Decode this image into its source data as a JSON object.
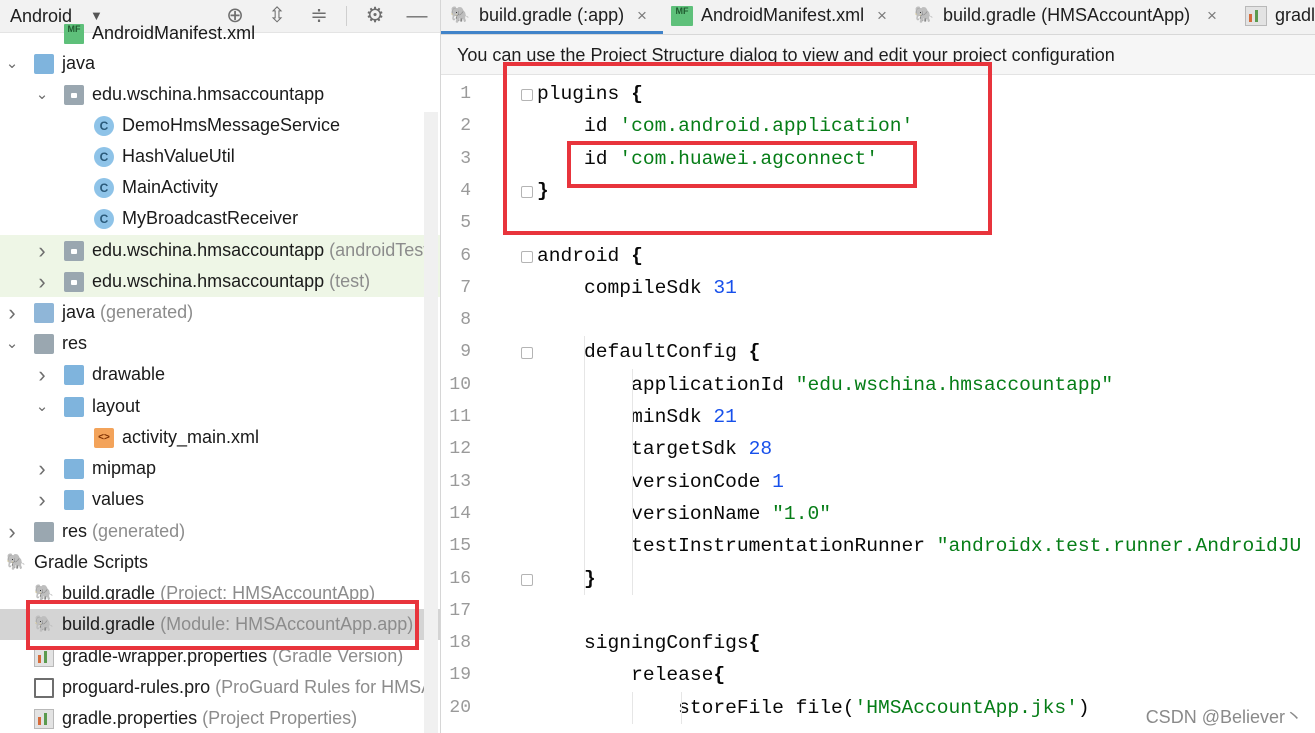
{
  "project_panel": {
    "view_mode": "Android",
    "toolbar_icons": [
      "locate-icon",
      "expand-all-icon",
      "collapse-all-icon",
      "gear-icon",
      "hide-icon"
    ],
    "rows": [
      {
        "label": "AndroidManifest.xml",
        "sub": "",
        "icon": "manifest-icon"
      },
      {
        "label": "java",
        "sub": "",
        "icon": "folder-icon",
        "arrow": "down"
      },
      {
        "label": "edu.wschina.hmsaccountapp",
        "sub": "",
        "icon": "package-icon",
        "arrow": "down"
      },
      {
        "label": "DemoHmsMessageService",
        "sub": "",
        "icon": "class-icon"
      },
      {
        "label": "HashValueUtil",
        "sub": "",
        "icon": "class-icon"
      },
      {
        "label": "MainActivity",
        "sub": "",
        "icon": "class-icon"
      },
      {
        "label": "MyBroadcastReceiver",
        "sub": "",
        "icon": "class-icon"
      },
      {
        "label": "edu.wschina.hmsaccountapp",
        "sub": "(androidTest)",
        "icon": "package-icon",
        "arrow": "right"
      },
      {
        "label": "edu.wschina.hmsaccountapp",
        "sub": "(test)",
        "icon": "package-icon",
        "arrow": "right"
      },
      {
        "label": "java",
        "sub": "(generated)",
        "icon": "generated-folder-icon",
        "arrow": "right"
      },
      {
        "label": "res",
        "sub": "",
        "icon": "resource-folder-icon",
        "arrow": "down"
      },
      {
        "label": "drawable",
        "sub": "",
        "icon": "folder-icon",
        "arrow": "right"
      },
      {
        "label": "layout",
        "sub": "",
        "icon": "folder-icon",
        "arrow": "down"
      },
      {
        "label": "activity_main.xml",
        "sub": "",
        "icon": "xml-file-icon"
      },
      {
        "label": "mipmap",
        "sub": "",
        "icon": "folder-icon",
        "arrow": "right"
      },
      {
        "label": "values",
        "sub": "",
        "icon": "folder-icon",
        "arrow": "right"
      },
      {
        "label": "res",
        "sub": "(generated)",
        "icon": "resource-folder-icon",
        "arrow": "right"
      },
      {
        "label": "Gradle Scripts",
        "sub": "",
        "icon": "gradle-elephant-icon",
        "arrow": "down"
      },
      {
        "label": "build.gradle",
        "sub": "(Project: HMSAccountApp)",
        "icon": "gradle-elephant-icon"
      },
      {
        "label": "build.gradle",
        "sub": "(Module: HMSAccountApp.app)",
        "icon": "gradle-elephant-icon",
        "selected": true
      },
      {
        "label": "gradle-wrapper.properties",
        "sub": "(Gradle Version)",
        "icon": "properties-icon"
      },
      {
        "label": "proguard-rules.pro",
        "sub": "(ProGuard Rules for HMSA",
        "icon": "document-icon"
      },
      {
        "label": "gradle.properties",
        "sub": "(Project Properties)",
        "icon": "properties-icon"
      }
    ]
  },
  "tabs": [
    {
      "label": "build.gradle (:app)",
      "icon": "gradle-elephant-icon",
      "active": true,
      "close": "×"
    },
    {
      "label": "AndroidManifest.xml",
      "icon": "manifest-icon",
      "active": false,
      "close": "×"
    },
    {
      "label": "build.gradle (HMSAccountApp)",
      "icon": "gradle-elephant-icon",
      "active": false,
      "close": "×"
    },
    {
      "label": "gradl",
      "icon": "properties-icon",
      "active": false,
      "close": ""
    }
  ],
  "banner": {
    "text": "You can use the Project Structure dialog to view and edit your project configuration"
  },
  "editor": {
    "lines": [
      {
        "n": "1",
        "tokens": [
          {
            "t": "plugins ",
            "c": ""
          },
          {
            "t": "{",
            "c": "brk"
          }
        ]
      },
      {
        "n": "2",
        "tokens": [
          {
            "t": "    id ",
            "c": ""
          },
          {
            "t": "'com.android.application'",
            "c": "str"
          }
        ]
      },
      {
        "n": "3",
        "tokens": [
          {
            "t": "    id ",
            "c": ""
          },
          {
            "t": "'com.huawei.agconnect'",
            "c": "str"
          }
        ]
      },
      {
        "n": "4",
        "tokens": [
          {
            "t": "}",
            "c": "brk"
          }
        ]
      },
      {
        "n": "5",
        "tokens": []
      },
      {
        "n": "6",
        "tokens": [
          {
            "t": "android ",
            "c": ""
          },
          {
            "t": "{",
            "c": "brk"
          }
        ]
      },
      {
        "n": "7",
        "tokens": [
          {
            "t": "    compileSdk ",
            "c": ""
          },
          {
            "t": "31",
            "c": "num"
          }
        ]
      },
      {
        "n": "8",
        "tokens": []
      },
      {
        "n": "9",
        "tokens": [
          {
            "t": "    defaultConfig ",
            "c": ""
          },
          {
            "t": "{",
            "c": "brk"
          }
        ]
      },
      {
        "n": "10",
        "tokens": [
          {
            "t": "        applicationId ",
            "c": ""
          },
          {
            "t": "\"edu.wschina.hmsaccountapp\"",
            "c": "str"
          }
        ]
      },
      {
        "n": "11",
        "tokens": [
          {
            "t": "        minSdk ",
            "c": ""
          },
          {
            "t": "21",
            "c": "num"
          }
        ]
      },
      {
        "n": "12",
        "tokens": [
          {
            "t": "        targetSdk ",
            "c": ""
          },
          {
            "t": "28",
            "c": "num"
          }
        ]
      },
      {
        "n": "13",
        "tokens": [
          {
            "t": "        versionCode ",
            "c": ""
          },
          {
            "t": "1",
            "c": "num"
          }
        ]
      },
      {
        "n": "14",
        "tokens": [
          {
            "t": "        versionName ",
            "c": ""
          },
          {
            "t": "\"1.0\"",
            "c": "str"
          }
        ]
      },
      {
        "n": "15",
        "tokens": [
          {
            "t": "        testInstrumentationRunner ",
            "c": ""
          },
          {
            "t": "\"androidx.test.runner.AndroidJU",
            "c": "str"
          }
        ]
      },
      {
        "n": "16",
        "tokens": [
          {
            "t": "    }",
            "c": "brk"
          }
        ]
      },
      {
        "n": "17",
        "tokens": []
      },
      {
        "n": "18",
        "tokens": [
          {
            "t": "    signingConfigs",
            "c": ""
          },
          {
            "t": "{",
            "c": "brk"
          }
        ]
      },
      {
        "n": "19",
        "tokens": [
          {
            "t": "        release",
            "c": ""
          },
          {
            "t": "{",
            "c": "brk"
          }
        ]
      },
      {
        "n": "20",
        "tokens": [
          {
            "t": "            storeFile file(",
            "c": ""
          },
          {
            "t": "'HMSAccountApp.jks'",
            "c": "str"
          },
          {
            "t": ")",
            "c": ""
          }
        ]
      }
    ]
  },
  "watermark": "CSDN @Believer丶",
  "colors": {
    "highlight_box": "#e8343c",
    "string": "#067d17",
    "number": "#1750eb",
    "active_tab_underline": "#4083c9"
  }
}
